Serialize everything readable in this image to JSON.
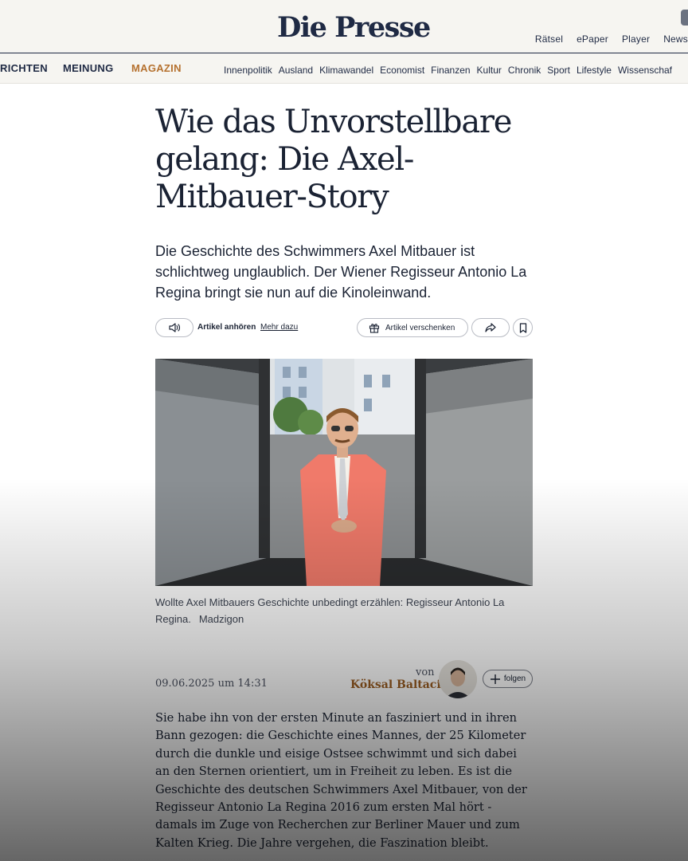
{
  "header": {
    "logo": "Die Presse",
    "top_links": [
      "Rätsel",
      "ePaper",
      "Player",
      "News"
    ]
  },
  "nav": {
    "main": [
      "RICHTEN",
      "MEINUNG",
      "MAGAZIN"
    ],
    "sections": [
      "Innenpolitik",
      "Ausland",
      "Klimawandel",
      "Economist",
      "Finanzen",
      "Kultur",
      "Chronik",
      "Sport",
      "Lifestyle",
      "Wissenschaf"
    ],
    "accent_color": "#b5712f"
  },
  "article": {
    "headline": "Wie das Unvorstellbare gelang: Die Axel-Mitbauer-Story",
    "lead": "Die Geschichte des Schwimmers Axel Mitbauer ist schlichtweg unglaublich. Der Wiener Regisseur Antonio La Regina bringt sie nun auf die Kinoleinwand.",
    "actions": {
      "listen": "Artikel anhören",
      "more": "Mehr dazu",
      "gift": "Artikel verschenken"
    },
    "image_caption": "Wollte Axel Mitbauers Geschichte unbedingt erzählen: Regisseur Antonio La Regina.",
    "image_credit": "Madzigon",
    "date": "09.06.2025 um 14:31",
    "byline_prefix": "von",
    "author": "Köksal Baltaci",
    "follow": "folgen",
    "body": "Sie habe ihn von der ersten Minute an fasziniert und in ihren Bann gezogen: die Geschichte eines Mannes, der 25 Kilometer durch die dunkle und eisige Ostsee schwimmt und sich dabei an den Sternen orientiert, um in Freiheit zu leben. Es ist die Geschichte des deutschen Schwimmers Axel Mitbauer, von der Regisseur Antonio La Regina 2016 zum ersten Mal hört - damals im Zuge von Recherchen zur Berliner Mauer und zum Kalten Krieg. Die Jahre vergehen, die Faszination bleibt."
  },
  "icons": [
    "speaker-icon",
    "gift-icon",
    "share-icon",
    "bookmark-icon",
    "plus-icon"
  ]
}
